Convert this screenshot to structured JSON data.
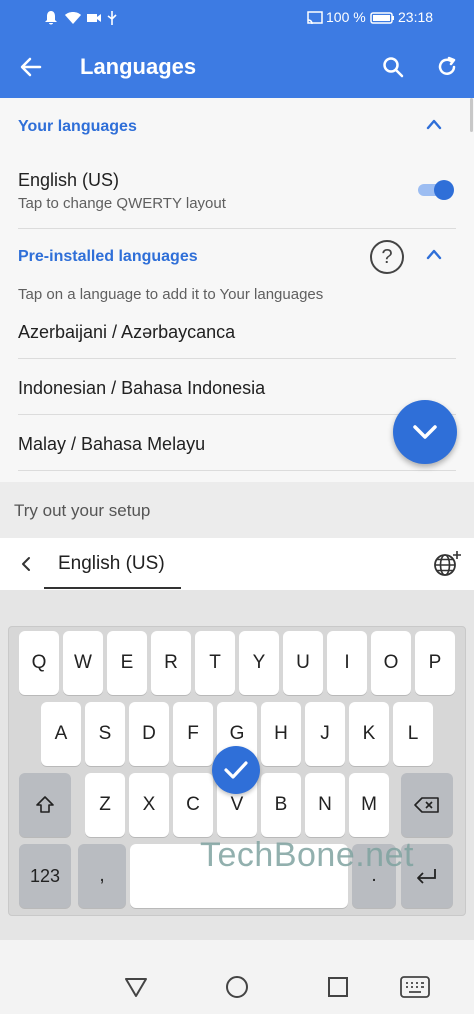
{
  "status_bar": {
    "battery_percent": "100 %",
    "time": "23:18",
    "icons": [
      "notification-icon",
      "wifi-icon",
      "video-icon",
      "usb-icon",
      "cast-icon",
      "battery-icon"
    ]
  },
  "app_bar": {
    "title": "Languages",
    "icons": [
      "back-arrow-icon",
      "search-icon",
      "refresh-icon"
    ]
  },
  "your_languages": {
    "header": "Your languages",
    "items": [
      {
        "name": "English (US)",
        "subtitle": "Tap to change QWERTY layout",
        "enabled": true
      }
    ]
  },
  "preinstalled": {
    "header": "Pre-installed languages",
    "hint": "Tap on a language to add it to Your languages",
    "items": [
      "Azerbaijani / Azərbaycanca",
      "Indonesian / Bahasa Indonesia",
      "Malay / Bahasa Melayu"
    ]
  },
  "tryout": {
    "label": "Try out your setup",
    "selected_language": "English (US)"
  },
  "keyboard": {
    "row1": [
      "Q",
      "W",
      "E",
      "R",
      "T",
      "Y",
      "U",
      "I",
      "O",
      "P"
    ],
    "row2": [
      "A",
      "S",
      "D",
      "F",
      "G",
      "H",
      "J",
      "K",
      "L"
    ],
    "row3": [
      "Z",
      "X",
      "C",
      "V",
      "B",
      "N",
      "M"
    ],
    "numbers_key": "123",
    "comma_key": ",",
    "period_key": "."
  },
  "watermark": "TechBone.net",
  "colors": {
    "accent": "#3d7be3",
    "primary_text": "#212121"
  }
}
